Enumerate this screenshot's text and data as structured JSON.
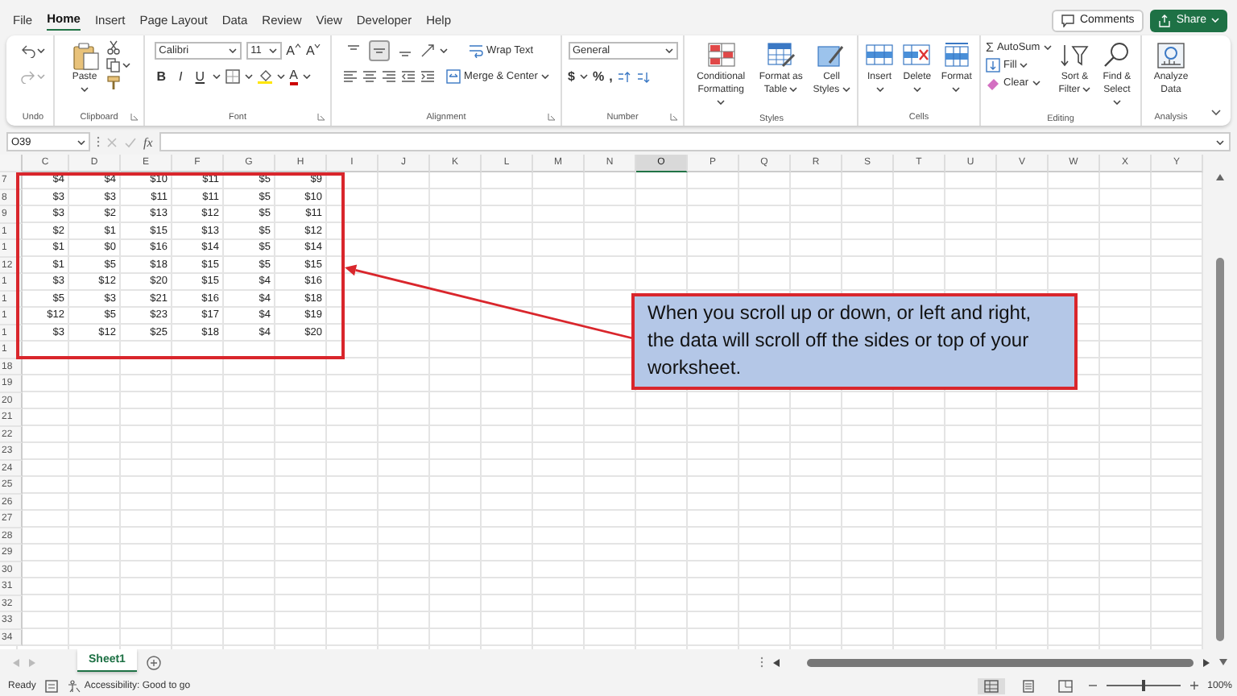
{
  "ribbon_tabs": [
    {
      "label": "File",
      "selected": false
    },
    {
      "label": "Home",
      "selected": true
    },
    {
      "label": "Insert",
      "selected": false
    },
    {
      "label": "Page Layout",
      "selected": false
    },
    {
      "label": "Data",
      "selected": false
    },
    {
      "label": "Review",
      "selected": false
    },
    {
      "label": "View",
      "selected": false
    },
    {
      "label": "Developer",
      "selected": false
    },
    {
      "label": "Help",
      "selected": false
    }
  ],
  "header_buttons": {
    "comments": "Comments",
    "share": "Share"
  },
  "ribbon": {
    "undo": {
      "label": "Undo"
    },
    "clipboard": {
      "label": "Clipboard",
      "paste": "Paste"
    },
    "font": {
      "label": "Font",
      "font_name": "Calibri",
      "font_size": "11",
      "size_buttons": [
        "A",
        "A"
      ],
      "format_buttons": [
        "B",
        "I",
        "U"
      ],
      "font_color": "A"
    },
    "alignment": {
      "label": "Alignment",
      "vertical_align": [
        {
          "selected": false
        },
        {
          "selected": true
        },
        {
          "selected": false
        }
      ],
      "wrap_text": "Wrap Text",
      "merge_center": "Merge & Center"
    },
    "number": {
      "label": "Number",
      "format": "General",
      "symbols": [
        "$",
        "%",
        ","
      ]
    },
    "styles": {
      "label": "Styles",
      "buttons": [
        {
          "label": "Conditional Formatting",
          "dropdown": true
        },
        {
          "label": "Format as Table",
          "dropdown": true
        },
        {
          "label": "Cell Styles",
          "dropdown": true
        }
      ]
    },
    "cells": {
      "label": "Cells",
      "buttons": [
        {
          "label": "Insert",
          "dropdown": true
        },
        {
          "label": "Delete",
          "dropdown": true
        },
        {
          "label": "Format",
          "dropdown": true
        }
      ]
    },
    "editing": {
      "label": "Editing",
      "autosum_symbol": "Σ",
      "small_buttons": [
        {
          "label": "AutoSum",
          "dropdown": true
        },
        {
          "label": "Fill",
          "dropdown": true
        },
        {
          "label": "Clear",
          "dropdown": true
        }
      ],
      "buttons": [
        {
          "label": "Sort & Filter",
          "dropdown": true
        },
        {
          "label": "Find & Select",
          "dropdown": true
        }
      ]
    },
    "analysis": {
      "label": "Analysis",
      "buttons": [
        {
          "label": "Analyze Data",
          "dropdown": false
        }
      ]
    }
  },
  "formula_bar": {
    "name_box": "O39",
    "function_label": "fx"
  },
  "sheet": {
    "columns": [
      {
        "label": "C",
        "selected": false
      },
      {
        "label": "D",
        "selected": false
      },
      {
        "label": "E",
        "selected": false
      },
      {
        "label": "F",
        "selected": false
      },
      {
        "label": "G",
        "selected": false
      },
      {
        "label": "H",
        "selected": false
      },
      {
        "label": "I",
        "selected": false
      },
      {
        "label": "J",
        "selected": false
      },
      {
        "label": "K",
        "selected": false
      },
      {
        "label": "L",
        "selected": false
      },
      {
        "label": "M",
        "selected": false
      },
      {
        "label": "N",
        "selected": false
      },
      {
        "label": "O",
        "selected": true
      },
      {
        "label": "P",
        "selected": false
      },
      {
        "label": "Q",
        "selected": false
      },
      {
        "label": "R",
        "selected": false
      },
      {
        "label": "S",
        "selected": false
      },
      {
        "label": "T",
        "selected": false
      },
      {
        "label": "U",
        "selected": false
      },
      {
        "label": "V",
        "selected": false
      },
      {
        "label": "W",
        "selected": false
      },
      {
        "label": "X",
        "selected": false
      },
      {
        "label": "Y",
        "selected": false
      }
    ],
    "rows": [
      {
        "number": "7",
        "cells": [
          "$4",
          "$4",
          "$10",
          "$11",
          "$5",
          "$9"
        ]
      },
      {
        "number": "8",
        "cells": [
          "$3",
          "$3",
          "$11",
          "$11",
          "$5",
          "$10"
        ]
      },
      {
        "number": "9",
        "cells": [
          "$3",
          "$2",
          "$13",
          "$12",
          "$5",
          "$11"
        ]
      },
      {
        "number": "1",
        "cells": [
          "$2",
          "$1",
          "$15",
          "$13",
          "$5",
          "$12"
        ]
      },
      {
        "number": "1",
        "cells": [
          "$1",
          "$0",
          "$16",
          "$14",
          "$5",
          "$14"
        ]
      },
      {
        "number": "12",
        "cells": [
          "$1",
          "$5",
          "$18",
          "$15",
          "$5",
          "$15"
        ]
      },
      {
        "number": "1",
        "cells": [
          "$3",
          "$12",
          "$20",
          "$15",
          "$4",
          "$16"
        ]
      },
      {
        "number": "1",
        "cells": [
          "$5",
          "$3",
          "$21",
          "$16",
          "$4",
          "$18"
        ]
      },
      {
        "number": "1",
        "cells": [
          "$12",
          "$5",
          "$23",
          "$17",
          "$4",
          "$19"
        ]
      },
      {
        "number": "1",
        "cells": [
          "$3",
          "$12",
          "$25",
          "$18",
          "$4",
          "$20"
        ]
      },
      {
        "number": "1"
      },
      {
        "number": "18"
      },
      {
        "number": "19"
      },
      {
        "number": "20"
      },
      {
        "number": "21"
      },
      {
        "number": "22"
      },
      {
        "number": "23"
      },
      {
        "number": "24"
      },
      {
        "number": "25"
      },
      {
        "number": "26"
      },
      {
        "number": "27"
      },
      {
        "number": "28"
      },
      {
        "number": "29"
      },
      {
        "number": "30"
      },
      {
        "number": "31"
      },
      {
        "number": "32"
      },
      {
        "number": "33"
      },
      {
        "number": "34"
      }
    ]
  },
  "callout": {
    "text": "When you scroll up or down, or left and right, the data will scroll off the sides or top of your worksheet."
  },
  "sheet_tabs": [
    {
      "label": "Sheet1",
      "selected": true
    }
  ],
  "status_bar": {
    "mode": "Ready",
    "accessibility": "Accessibility: Good to go",
    "view_buttons": [
      {
        "selected": true
      },
      {
        "selected": false
      },
      {
        "selected": false
      }
    ],
    "zoom_slider": {
      "level": 0.5
    },
    "zoom": "100%"
  }
}
